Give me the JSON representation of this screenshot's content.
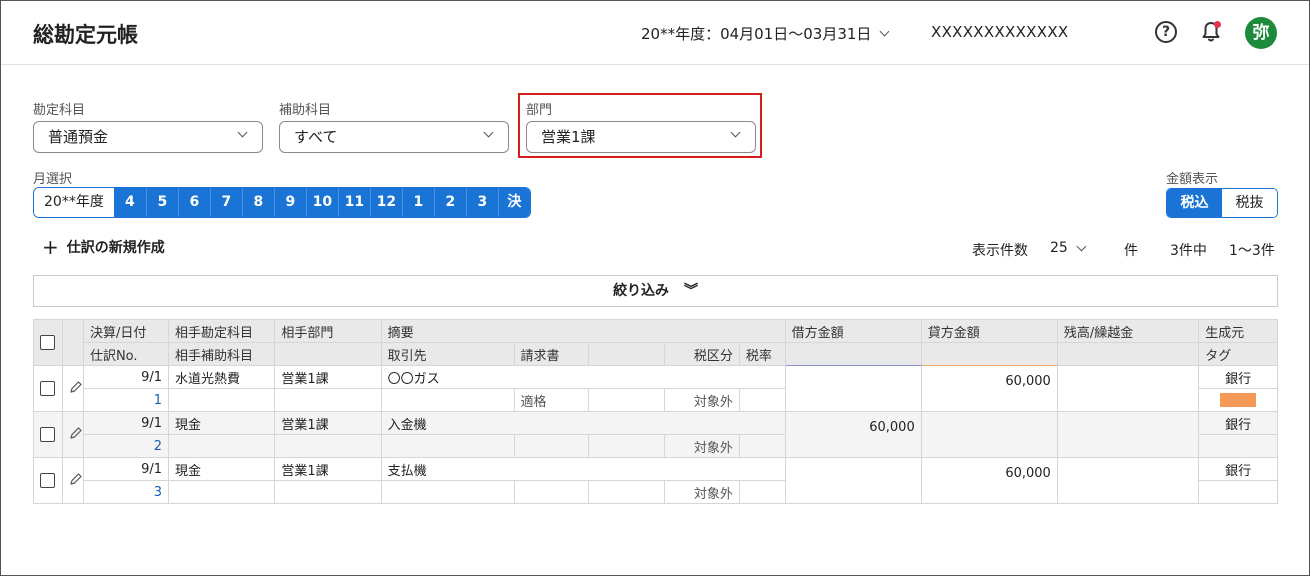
{
  "header": {
    "app_title": "総勘定元帳",
    "period": "20**年度：04月01日〜03月31日",
    "company": "XXXXXXXXXXXXX",
    "help_glyph": "?",
    "avatar_initial": "弥"
  },
  "filters": {
    "account_label": "勘定科目",
    "account_value": "普通預金",
    "sub_account_label": "補助科目",
    "sub_account_value": "すべて",
    "department_label": "部門",
    "department_value": "営業1課",
    "highlight_color": "#d41d1d"
  },
  "months": {
    "label": "月選択",
    "year": "20**年度",
    "items": [
      "4",
      "5",
      "6",
      "7",
      "8",
      "9",
      "10",
      "11",
      "12",
      "1",
      "2",
      "3",
      "決"
    ]
  },
  "amount_display": {
    "label": "金額表示",
    "options": [
      "税込",
      "税抜"
    ],
    "selected": "税込"
  },
  "toolbar": {
    "new_entry": "仕訳の新規作成",
    "per_page_label": "表示件数",
    "per_page_value": "25",
    "per_page_unit": "件",
    "count_total": "3件中",
    "count_range": "1〜3件",
    "filter_label": "絞り込み"
  },
  "table": {
    "headers_row1": [
      "決算/日付",
      "相手勘定科目",
      "相手部門",
      "摘要",
      "借方金額",
      "貸方金額",
      "残高/繰越金",
      "生成元"
    ],
    "headers_row2": [
      "仕訳No.",
      "相手補助科目",
      "取引先",
      "請求書",
      "税区分",
      "税率",
      "タグ"
    ],
    "rows": [
      {
        "date": "9/1",
        "no": "1",
        "account": "水道光熱費",
        "department": "営業1課",
        "summary": "〇〇ガス",
        "invoice": "適格",
        "tax_category": "対象外",
        "debit": "",
        "credit": "60,000",
        "balance": "",
        "source": "銀行",
        "tag_color": "#f59a56"
      },
      {
        "date": "9/1",
        "no": "2",
        "account": "現金",
        "department": "営業1課",
        "summary": "入金機",
        "invoice": "",
        "tax_category": "対象外",
        "debit": "60,000",
        "credit": "",
        "balance": "",
        "source": "銀行",
        "tag_color": ""
      },
      {
        "date": "9/1",
        "no": "3",
        "account": "現金",
        "department": "営業1課",
        "summary": "支払機",
        "invoice": "",
        "tax_category": "対象外",
        "debit": "",
        "credit": "60,000",
        "balance": "",
        "source": "銀行",
        "tag_color": ""
      }
    ]
  },
  "colors": {
    "accent": "#1a74d6",
    "avatar_bg": "#1e8a3c",
    "notification_dot": "#e8334a",
    "debit_line": "#8b93c9",
    "credit_line": "#f0a868"
  }
}
